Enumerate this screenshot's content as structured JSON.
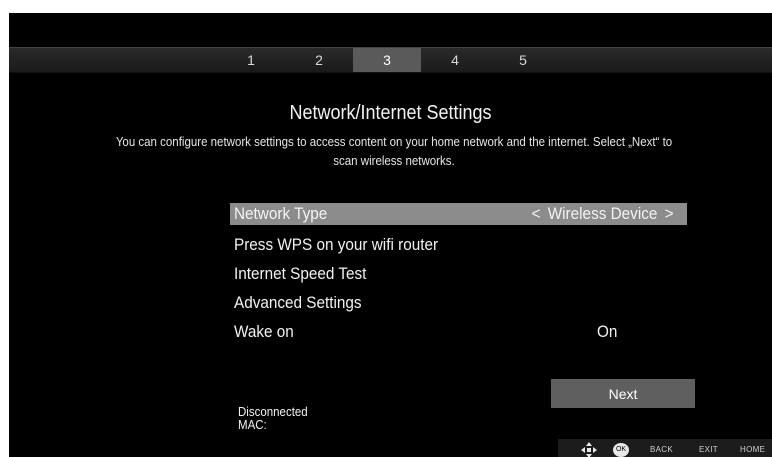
{
  "steps": [
    "1",
    "2",
    "3",
    "4",
    "5"
  ],
  "active_step": "3",
  "title": "Network/Internet Settings",
  "description": "You can configure network settings to access content on your home network and the internet. Select „Next“ to scan wireless networks.",
  "menu": {
    "network_type": {
      "label": "Network Type",
      "value": "Wireless Device",
      "left_arrow": "<",
      "right_arrow": ">"
    },
    "wps": {
      "label": "Press WPS on your wifi router"
    },
    "speed_test": {
      "label": "Internet Speed Test"
    },
    "advanced": {
      "label": "Advanced Settings"
    },
    "wake_on": {
      "label": "Wake on",
      "value": "On"
    }
  },
  "next_label": "Next",
  "status": {
    "connection": "Disconnected",
    "mac": "MAC:"
  },
  "hints": {
    "ok": "OK",
    "back": "BACK",
    "exit": "EXIT",
    "home": "HOME"
  },
  "colors": {
    "background": "#000000",
    "selected_row": "#8c8c8c",
    "active_step": "#5a5a5a",
    "button": "#5f5f5f"
  }
}
